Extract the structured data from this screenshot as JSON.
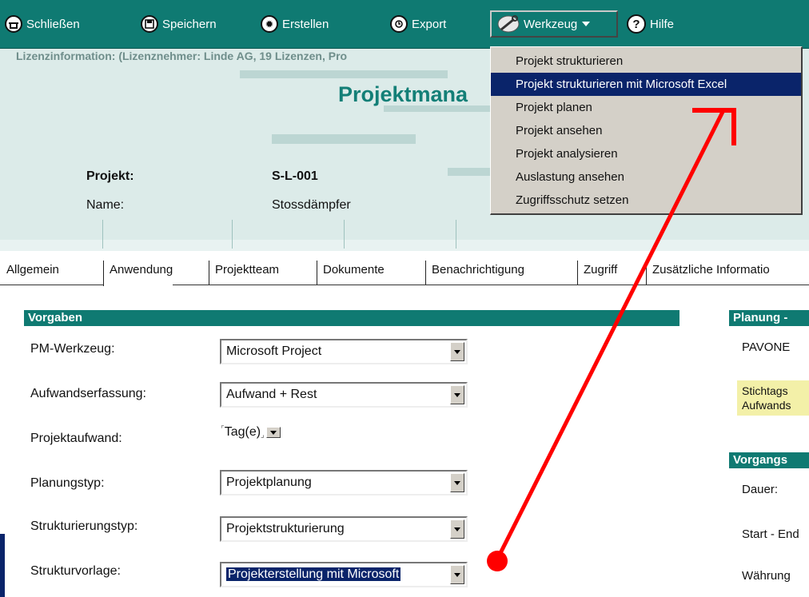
{
  "toolbar": {
    "close_label": "Schließen",
    "save_label": "Speichern",
    "create_label": "Erstellen",
    "export_label": "Export",
    "tools_label": "Werkzeug",
    "help_label": "Hilfe"
  },
  "header": {
    "license_info": "Lizenzinformation: (Lizenznehmer: Linde AG, 19 Lizenzen, Pro",
    "title": "Projektmana",
    "project_label": "Projekt:",
    "project_value": "S-L-001",
    "name_label": "Name:",
    "name_value": "Stossdämpfer"
  },
  "tabs": [
    "Allgemein",
    "Anwendung",
    "Projektteam",
    "Dokumente",
    "Benachrichtigung",
    "Zugriff",
    "Zusätzliche Informatio"
  ],
  "active_tab": "Anwendung",
  "vorgaben": {
    "title": "Vorgaben",
    "pm_tool_label": "PM-Werkzeug:",
    "pm_tool_value": "Microsoft Project",
    "effort_capture_label": "Aufwandserfassung:",
    "effort_capture_value": "Aufwand + Rest",
    "project_effort_label": "Projektaufwand:",
    "project_effort_value": "Tag(e)",
    "planning_type_label": "Planungstyp:",
    "planning_type_value": "Projektplanung",
    "structuring_type_label": "Strukturierungstyp:",
    "structuring_type_value": "Projektstrukturierung",
    "structure_template_label": "Strukturvorlage:",
    "structure_template_value": "Projekterstellung mit Microsoft"
  },
  "right_panel": {
    "planning_title": "Planung -",
    "pavone_text": "PAVONE",
    "note_line1": "Stichtags",
    "note_line2": "Aufwands",
    "process_title": "Vorgangs",
    "duration_label": "Dauer:",
    "start_end_label": "Start - End",
    "currency_label": "Währung"
  },
  "tools_menu": {
    "items": [
      "Projekt strukturieren",
      "Projekt strukturieren mit Microsoft Excel",
      "Projekt planen",
      "Projekt ansehen",
      "Projekt analysieren",
      "Auslastung ansehen",
      "Zugriffsschutz setzen"
    ],
    "highlighted_index": 1
  },
  "colors": {
    "toolbar_bg": "#0f7a72",
    "menu_highlight": "#0a246a",
    "annotation_red": "#ff0000",
    "note_yellow": "#f3f0a8"
  },
  "icons": {
    "close": "close-circle-icon",
    "save": "floppy-disk-icon",
    "create": "sparkle-create-icon",
    "export": "export-icon",
    "tools": "wrench-icon",
    "help": "question-mark-icon"
  }
}
